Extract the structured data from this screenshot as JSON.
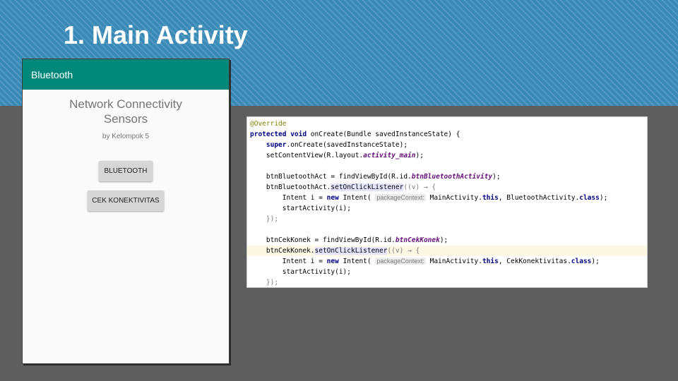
{
  "slide": {
    "title": "1. Main Activity"
  },
  "app": {
    "toolbar_title": "Bluetooth",
    "heading": "Network Connectivity\nSensors",
    "byline": "by Kelompok 5",
    "btn_bluetooth": "BLUETOOTH",
    "btn_cek": "CEK KONEKTIVITAS"
  },
  "code": {
    "l1": "@Override",
    "l2a": "protected void",
    "l2b": " onCreate(Bundle savedInstanceState) {",
    "l3a": "    super",
    "l3b": ".onCreate(savedInstanceState);",
    "l4a": "    setContentView(R.layout.",
    "l4b": "activity_main",
    "l4c": ");",
    "l6a": "    btnBluetoothAct = findViewById(R.id.",
    "l6b": "btnBluetoothActivity",
    "l6c": ");",
    "l7a": "    btnBluetoothAct.",
    "l7b": "setOnClickListener",
    "l7c": "((v) → {",
    "l8a": "        Intent i = ",
    "l8b": "new",
    "l8c": " Intent( ",
    "hint1": "packageContext:",
    "l8d": " MainActivity.",
    "l8e": "this",
    "l8f": ", BluetoothActivity.",
    "l8g": "class",
    "l8h": ");",
    "l9": "        startActivity(i);",
    "l10": "    });",
    "l12a": "    btnCekKonek = findViewById(R.id.",
    "l12b": "btnCekKonek",
    "l12c": ");",
    "l13a": "    btnCekKonek.",
    "l13b": "setOnClickListener",
    "l13c": "((v) → {",
    "l14a": "        Intent i = ",
    "l14b": "new",
    "l14c": " Intent( ",
    "hint2": "packageContext:",
    "l14d": " MainActivity.",
    "l14e": "this",
    "l14f": ", CekKonektivitas.",
    "l14g": "class",
    "l14h": ");",
    "l15": "        startActivity(i);",
    "l16": "    });"
  }
}
